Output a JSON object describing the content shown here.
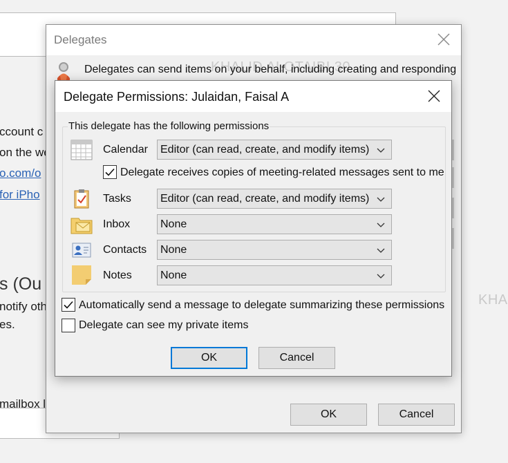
{
  "background": {
    "lines": [
      "ccount c",
      "on the we"
    ],
    "links": [
      "o.com/o",
      " for iPho"
    ],
    "heading": "s (Ou",
    "para": [
      "notify oth",
      "es."
    ],
    "mailbox": "mailbox l",
    "watermarks": [
      "KHALID ALOTAIBI 30",
      "KHA"
    ]
  },
  "delegates_dialog": {
    "title": "Delegates",
    "description": "Delegates can send items on your behalf, including creating and responding",
    "icons": {
      "close": "close-icon",
      "delegates": "delegate-person-icon"
    },
    "ok_label": "OK",
    "cancel_label": "Cancel"
  },
  "permissions_dialog": {
    "title": "Delegate Permissions: Julaidan, Faisal A",
    "group_caption": "This delegate has the following permissions",
    "rows": [
      {
        "label": "Calendar",
        "value": "Editor (can read, create, and modify items)",
        "icon": "calendar-icon"
      },
      {
        "label": "Tasks",
        "value": "Editor (can read, create, and modify items)",
        "icon": "tasks-icon"
      },
      {
        "label": "Inbox",
        "value": "None",
        "icon": "inbox-icon"
      },
      {
        "label": "Contacts",
        "value": "None",
        "icon": "contacts-icon"
      },
      {
        "label": "Notes",
        "value": "None",
        "icon": "notes-icon"
      }
    ],
    "meeting_copies": {
      "label": "Delegate receives copies of meeting-related messages sent to me",
      "checked": true
    },
    "auto_send": {
      "label": "Automatically send a message to delegate summarizing these permissions",
      "checked": true
    },
    "private_items": {
      "label": "Delegate can see my private items",
      "checked": false
    },
    "ok_label": "OK",
    "cancel_label": "Cancel"
  },
  "colors": {
    "focus_border": "#0078d7",
    "dialog_bg": "#f0f0f0",
    "link": "#2a62b5"
  }
}
